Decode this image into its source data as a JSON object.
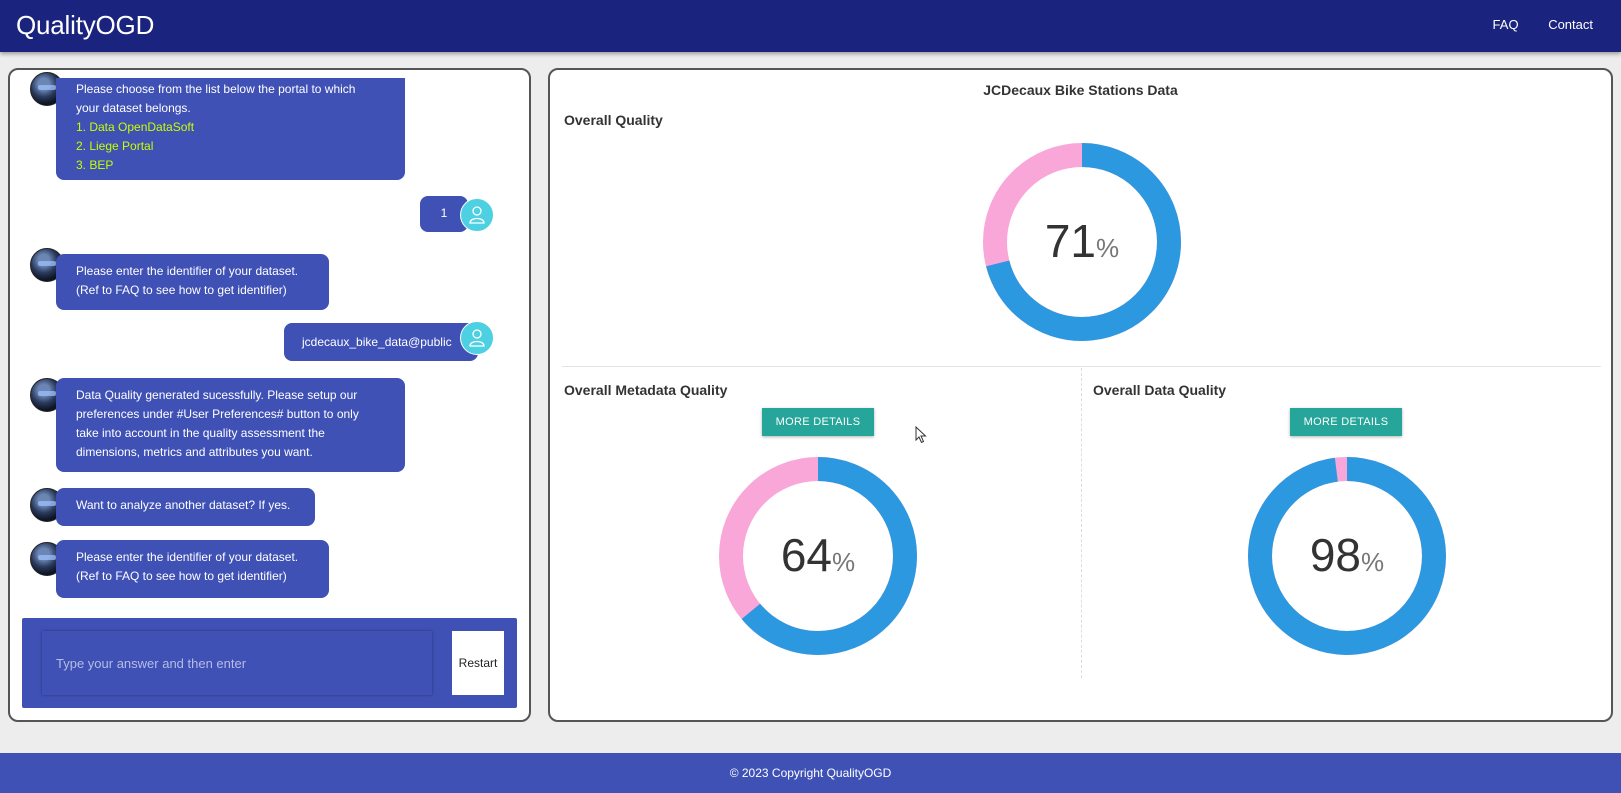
{
  "header": {
    "brand": "QualityOGD",
    "nav": [
      "FAQ",
      "Contact"
    ]
  },
  "chat": {
    "messages": [
      {
        "from": "bot",
        "lines": [
          "Please choose from the list below the portal to which",
          "your dataset belongs."
        ],
        "options": [
          "1. Data OpenDataSoft",
          "2. Liege Portal",
          "3. BEP"
        ]
      },
      {
        "from": "user",
        "text": "1"
      },
      {
        "from": "bot",
        "lines": [
          "Please enter the identifier of your dataset.",
          "(Ref to FAQ to see how to get identifier)"
        ]
      },
      {
        "from": "user",
        "text": "jcdecaux_bike_data@public"
      },
      {
        "from": "bot",
        "lines": [
          "Data Quality generated sucessfully. Please setup our",
          "preferences under #User Preferences# button to only",
          "take into account in the quality assessment the",
          "dimensions, metrics and attributes you want."
        ]
      },
      {
        "from": "bot",
        "lines": [
          "Want to analyze another dataset? If yes."
        ]
      },
      {
        "from": "bot",
        "lines": [
          "Please enter the identifier of your dataset.",
          "(Ref to FAQ to see how to get identifier)"
        ]
      }
    ],
    "input_placeholder": "Type your answer and then enter",
    "restart_label": "Restart"
  },
  "dashboard": {
    "title": "JCDecaux Bike Stations Data",
    "overall": {
      "label": "Overall Quality",
      "value": 71,
      "unit": "%"
    },
    "metadata": {
      "label": "Overall Metadata Quality",
      "value": 64,
      "unit": "%",
      "button": "MORE DETAILS"
    },
    "data": {
      "label": "Overall Data Quality",
      "value": 98,
      "unit": "%",
      "button": "MORE DETAILS"
    },
    "colors": {
      "filled": "#2c98e0",
      "remaining": "#f9a6d8"
    }
  },
  "footer": {
    "text": "© 2023 Copyright QualityOGD"
  }
}
